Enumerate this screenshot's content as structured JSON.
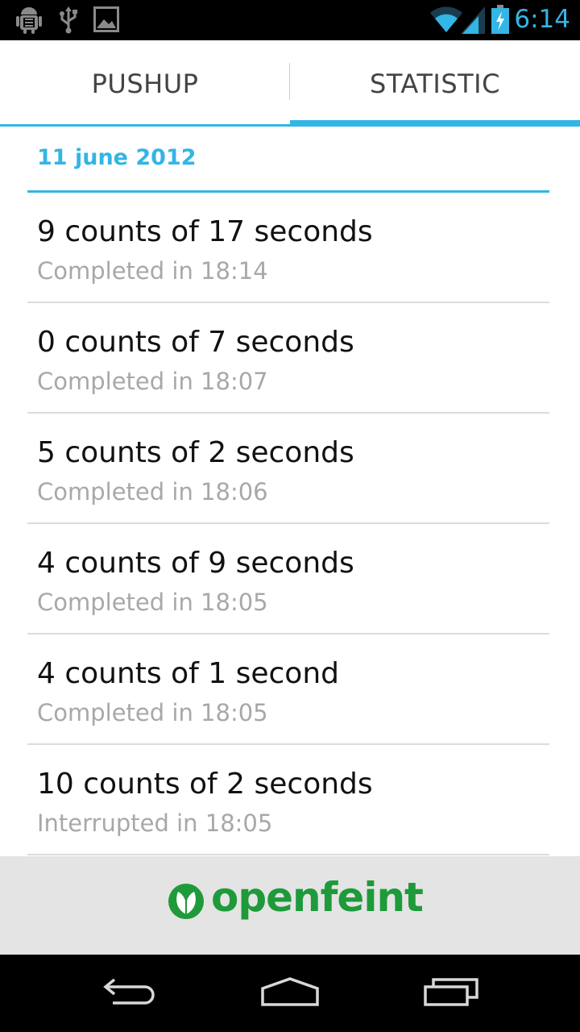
{
  "status_bar": {
    "time": "6:14",
    "icons": [
      "android-debug-icon",
      "usb-icon",
      "image-icon",
      "wifi-icon",
      "signal-icon",
      "battery-charging-icon"
    ]
  },
  "tabs": [
    {
      "label": "PUSHUP",
      "selected": false
    },
    {
      "label": "STATISTIC",
      "selected": true
    }
  ],
  "colors": {
    "accent": "#33b5e5",
    "brand": "#1e9a3a"
  },
  "statistic": {
    "date_header": "11 june 2012",
    "items": [
      {
        "title": "9 counts of 17 seconds",
        "subtitle": "Completed in 18:14"
      },
      {
        "title": "0 counts of 7 seconds",
        "subtitle": "Completed in 18:07"
      },
      {
        "title": "5 counts of 2 seconds",
        "subtitle": "Completed in 18:06"
      },
      {
        "title": "4 counts of 9 seconds",
        "subtitle": "Completed in 18:05"
      },
      {
        "title": "4 counts of 1 second",
        "subtitle": "Completed in 18:05"
      },
      {
        "title": "10 counts of 2 seconds",
        "subtitle": "Interrupted in 18:05"
      }
    ]
  },
  "ad": {
    "brand": "openfeint"
  },
  "nav": {
    "buttons": [
      "back-icon",
      "home-icon",
      "recent-apps-icon"
    ]
  }
}
